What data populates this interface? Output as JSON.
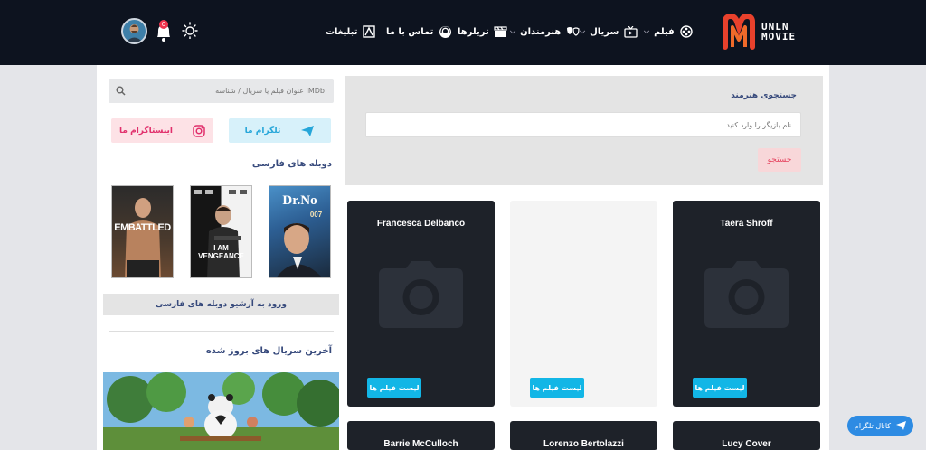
{
  "header": {
    "logo": {
      "line1": "UNLN",
      "line2": "MOVIE"
    },
    "nav": [
      {
        "label": "فیلم",
        "icon": "film-reel-icon",
        "dropdown": true
      },
      {
        "label": "سریال",
        "icon": "tv-icon",
        "dropdown": true
      },
      {
        "label": "هنرمندان",
        "icon": "masks-icon",
        "dropdown": true
      },
      {
        "label": "تریلرها",
        "icon": "clapperboard-icon",
        "dropdown": false
      },
      {
        "label": "تماس با ما",
        "icon": "support-icon",
        "dropdown": false
      },
      {
        "label": "تبلیغات",
        "icon": "ads-icon",
        "dropdown": false
      }
    ],
    "notification_count": "0"
  },
  "sidebar": {
    "search_placeholder": "عنوان فیلم یا سریال / شناسه IMDb",
    "telegram_label": "تلگرام ما",
    "instagram_label": "اینستاگرام ما",
    "dubbed_title": "دوبله های فارسی",
    "posters": [
      {
        "title": "Dr.No",
        "subtitle": "007"
      },
      {
        "title": "I AM VENGEANCE",
        "subtitle": ""
      },
      {
        "title": "EMBATTLED",
        "subtitle": ""
      }
    ],
    "archive_button": "ورود به آرشیو دوبله های فارسی",
    "latest_series_title": "آخرین سریال های بروز شده"
  },
  "main": {
    "artist_search_title": "جستجوی هنرمند",
    "artist_search_placeholder": "نام بازیگر را وارد کنید",
    "artist_search_button": "جستجو",
    "cards": [
      {
        "name": "Taera Shroff",
        "theme": "dark",
        "button": "لیست فیلم ها"
      },
      {
        "name": "",
        "theme": "light",
        "button": "لیست فیلم ها"
      },
      {
        "name": "Francesca Delbanco",
        "theme": "dark",
        "button": "لیست فیلم ها"
      }
    ],
    "cards_row2": [
      {
        "name": "Lucy Cover"
      },
      {
        "name": "Lorenzo Bertolazzi"
      },
      {
        "name": "Barrie McCulloch"
      }
    ]
  },
  "telegram_channel_button": "کانال تلگرام",
  "colors": {
    "header_bg": "#0d131f",
    "accent_cyan": "#12b6e6",
    "accent_red": "#e64560",
    "title_navy": "#374a7c",
    "telegram_blue": "#2d8be3"
  }
}
